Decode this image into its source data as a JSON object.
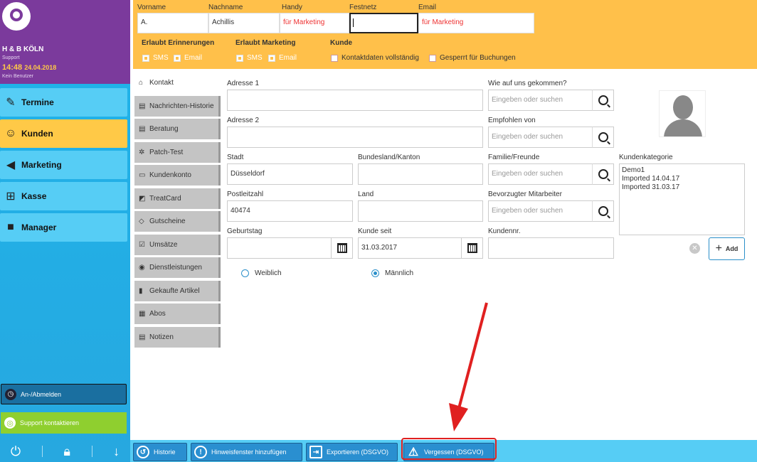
{
  "sidebar": {
    "salon": "H & B KÖLN",
    "support": "Support",
    "time": "14:48",
    "date": "24.04.2018",
    "user": "Kein Benutzer",
    "nav": [
      {
        "label": "Termine",
        "icon": "calendar-edit-icon"
      },
      {
        "label": "Kunden",
        "icon": "customer-icon"
      },
      {
        "label": "Marketing",
        "icon": "megaphone-icon"
      },
      {
        "label": "Kasse",
        "icon": "cart-icon"
      },
      {
        "label": "Manager",
        "icon": "briefcase-icon"
      }
    ],
    "login_label": "An-/Abmelden",
    "support_label": "Support kontaktieren"
  },
  "header": {
    "labels": {
      "vorname": "Vorname",
      "nachname": "Nachname",
      "handy": "Handy",
      "festnetz": "Festnetz",
      "email": "Email"
    },
    "values": {
      "vorname": "A.",
      "nachname": "Achillis",
      "handy": "für Marketing",
      "festnetz": "",
      "email": "für Marketing"
    },
    "sections": {
      "erinnerungen": "Erlaubt Erinnerungen",
      "marketing": "Erlaubt Marketing",
      "kunde": "Kunde"
    },
    "sms": "SMS",
    "email": "Email",
    "kontaktdaten": "Kontaktdaten vollständig",
    "gesperrt": "Gesperrt für Buchungen"
  },
  "tabs": [
    "Kontakt",
    "Nachrichten-Historie",
    "Beratung",
    "Patch-Test",
    "Kundenkonto",
    "TreatCard",
    "Gutscheine",
    "Umsätze",
    "Dienstleistungen",
    "Gekaufte Artikel",
    "Abos",
    "Notizen"
  ],
  "form": {
    "adresse1_label": "Adresse 1",
    "adresse2_label": "Adresse 2",
    "stadt_label": "Stadt",
    "stadt": "Düsseldorf",
    "bundesland_label": "Bundesland/Kanton",
    "plz_label": "Postleitzahl",
    "plz": "40474",
    "land_label": "Land",
    "geburtstag_label": "Geburtstag",
    "kunde_seit_label": "Kunde seit",
    "kunde_seit": "31.03.2017",
    "kundennr_label": "Kundennr.",
    "wie_label": "Wie auf uns gekommen?",
    "empfohlen_label": "Empfohlen von",
    "familie_label": "Familie/Freunde",
    "mitarbeiter_label": "Bevorzugter Mitarbeiter",
    "search_placeholder": "Eingeben oder suchen",
    "weiblich": "Weiblich",
    "maennlich": "Männlich",
    "kategorie_label": "Kundenkategorie",
    "kategorien": [
      "Demo1",
      "Imported 14.04.17",
      "Imported 31.03.17"
    ],
    "add_label": "Add"
  },
  "bottom": {
    "historie": "Historie",
    "hinweis": "Hinweisfenster hinzufügen",
    "export": "Exportieren (DSGVO)",
    "vergessen": "Vergessen (DSGVO)"
  },
  "colors": {
    "accent_orange": "#ffc04a",
    "brand_purple": "#7b3a9c",
    "sidebar_blue": "#1eb4ea",
    "annotation_red": "#e02020"
  }
}
